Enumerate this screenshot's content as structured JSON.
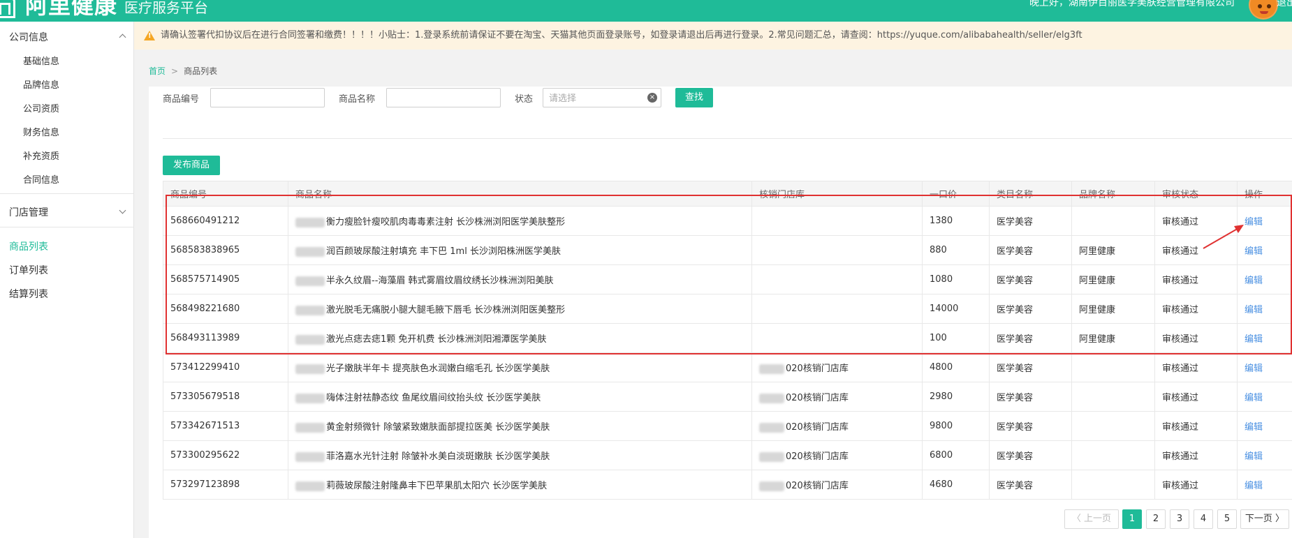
{
  "header": {
    "logo_title": "阿里健康",
    "logo_subtitle": "医疗服务平台",
    "greeting": "晚上好，湖南伊百丽医学美肤经营管理有限公司",
    "logout": "退出"
  },
  "sidebar": {
    "company_group": "公司信息",
    "company_items": [
      "基础信息",
      "品牌信息",
      "公司资质",
      "财务信息",
      "补充资质",
      "合同信息"
    ],
    "store_group": "门店管理",
    "items": [
      "商品列表",
      "订单列表",
      "结算列表"
    ],
    "active": "商品列表"
  },
  "notice": {
    "text": "请确认签署代扣协议后在进行合同签署和缴费！！！！小贴士：1.登录系统前请保证不要在淘宝、天猫其他页面登录账号，如登录请退出后再进行登录。2.常见问题汇总，请查阅：https://yuque.com/alibabahealth/seller/elg3ft"
  },
  "breadcrumb": {
    "home": "首页",
    "current": "商品列表"
  },
  "filters": {
    "code_label": "商品编号",
    "name_label": "商品名称",
    "status_label": "状态",
    "status_placeholder": "请选择",
    "search_button": "查找"
  },
  "publish_button": "发布商品",
  "table": {
    "headers": [
      "商品编号",
      "商品名称",
      "核销门店库",
      "一口价",
      "类目名称",
      "品牌名称",
      "审核状态",
      "操作"
    ],
    "rows": [
      [
        "568660491212",
        "衡力瘦脸针瘦咬肌肉毒毒素注射 长沙株洲浏阳医学美肤整形",
        "",
        "1380",
        "医学美容",
        "",
        "审核通过",
        "编辑"
      ],
      [
        "568583838965",
        "润百颜玻尿酸注射填充 丰下巴 1ml 长沙浏阳株洲医学美肤",
        "",
        "880",
        "医学美容",
        "阿里健康",
        "审核通过",
        "编辑"
      ],
      [
        "568575714905",
        "半永久纹眉--海藻眉 韩式雾眉纹眉纹绣长沙株洲浏阳美肤",
        "",
        "1080",
        "医学美容",
        "阿里健康",
        "审核通过",
        "编辑"
      ],
      [
        "568498221680",
        "激光脱毛无痛脱小腿大腿毛腋下唇毛 长沙株洲浏阳医美整形",
        "",
        "14000",
        "医学美容",
        "阿里健康",
        "审核通过",
        "编辑"
      ],
      [
        "568493113989",
        "激光点痣去痣1颗 免开机费 长沙株洲浏阳湘潭医学美肤",
        "",
        "100",
        "医学美容",
        "阿里健康",
        "审核通过",
        "编辑"
      ],
      [
        "573412299410",
        "光子嫩肤半年卡 提亮肤色水润嫩白缩毛孔 长沙医学美肤",
        "020核销门店库",
        "4800",
        "医学美容",
        "",
        "审核通过",
        "编辑"
      ],
      [
        "573305679518",
        "嗨体注射祛静态纹 鱼尾纹眉间纹抬头纹 长沙医学美肤",
        "020核销门店库",
        "2980",
        "医学美容",
        "",
        "审核通过",
        "编辑"
      ],
      [
        "573342671513",
        "黄金射频微针 除皱紧致嫩肤面部提拉医美 长沙医学美肤",
        "020核销门店库",
        "9800",
        "医学美容",
        "",
        "审核通过",
        "编辑"
      ],
      [
        "573300295622",
        "菲洛嘉水光针注射 除皱补水美白淡斑嫩肤 长沙医学美肤",
        "020核销门店库",
        "6800",
        "医学美容",
        "",
        "审核通过",
        "编辑"
      ],
      [
        "573297123898",
        "莉薇玻尿酸注射隆鼻丰下巴苹果肌太阳穴 长沙医学美肤",
        "020核销门店库",
        "4680",
        "医学美容",
        "",
        "审核通过",
        "编辑"
      ]
    ]
  },
  "pagination": {
    "prev": "〈 上一页",
    "pages": [
      "1",
      "2",
      "3",
      "4",
      "5"
    ],
    "current": "1",
    "next": "下一页 〉"
  },
  "colors": {
    "brand": "#1fbb98",
    "highlight": "#e03131",
    "link": "#4a90e2"
  }
}
